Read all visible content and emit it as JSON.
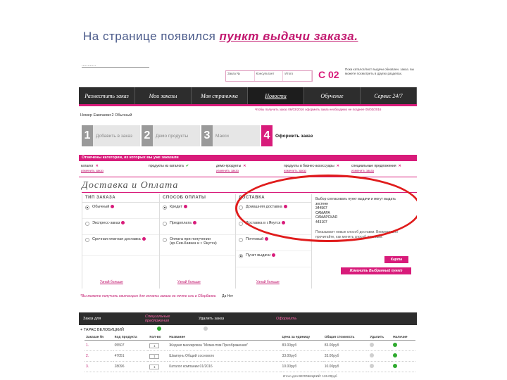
{
  "slide": {
    "title_prefix": "На странице появился",
    "title_highlight": "пункт выдачи заказа."
  },
  "header": {
    "logo_scrap": "............",
    "mini_table": [
      "Заказ №",
      "Консультант",
      "Итого"
    ],
    "cart_code": "С 02",
    "cart_note": "Пока каталог/лист выдачи обновлен. заказ. вы можете посмотреть в других разделах."
  },
  "nav": {
    "items": [
      "Разместить заказ",
      "Мои заказы",
      "Моя страничка",
      "Новости",
      "Обучение",
      "Сервис 24/7"
    ],
    "active_index": 3
  },
  "deadline_text": "Чтобы получить заказ 06/03/2016 оформить заказ необходимо не позднее 05/03/2016",
  "user_line": "Номер Еамгаеви:2  Обычный",
  "steps": [
    {
      "num": "1",
      "label": "Добавить в заказ"
    },
    {
      "num": "2",
      "label": "Демо продукты"
    },
    {
      "num": "3",
      "label": "Макси"
    },
    {
      "num": "4",
      "label": "Оформить заказ"
    }
  ],
  "active_step": 3,
  "categories_title": "Отмечены категории, из которых вы уже заказали",
  "categories": [
    {
      "name": "каталог",
      "mark": "x",
      "link": "изменить заказ"
    },
    {
      "name": "продукты из каталога",
      "mark": "ok",
      "link": ""
    },
    {
      "name": "демо-продукты",
      "mark": "x",
      "link": "изменить заказ"
    },
    {
      "name": "продукты в бизнес-аксессуары",
      "mark": "x",
      "link": "изменить заказ"
    },
    {
      "name": "специальные предложения",
      "mark": "x",
      "link": "изменить заказ"
    }
  ],
  "section_title": "Доставка и Оплата",
  "order_type": {
    "header": "ТИП ЗАКАЗА",
    "options": [
      "Обычный",
      "Экспресс-заказ",
      "Срочная платная доставка"
    ],
    "selected": 0,
    "more": "Узнай больше"
  },
  "payment": {
    "header": "СПОСОБ ОПЛАТЫ",
    "options": [
      "Кредит",
      "Предоплата",
      "Оплата при получении (кр.Сев.Кавказ и г. Якутск)"
    ],
    "selected": 0,
    "more": "Узнай больше"
  },
  "delivery": {
    "header": "ДОСТАВКА",
    "options": [
      "Домашняя доставка",
      "Доставка в г.Якутск",
      "Почтовый",
      "Пункт выдачи"
    ],
    "selected": 3,
    "more": "Узнай больше"
  },
  "pickup": {
    "intro": "Выбор согласовать пункт выдачи и могут выдать",
    "lines": [
      "зостенн",
      "344567",
      "САМАРА",
      "САМАРСКАЯ",
      "443107"
    ],
    "note": "Показывает новые способ доставки. Внимательно прочитайте, как менять способ доставки.",
    "map_button": "Карта",
    "change_button": "Изменить Выбранный пункт"
  },
  "pay_note": "*Вы можете получить квитанцию для оплаты заказа на почте или в Сбербанке.",
  "pay_note_radios": "Да     Нет",
  "order_header": {
    "col1": "Заказ для",
    "col2": "Специальные предложения",
    "col3": "Удалить заказ",
    "col4": "Оформить"
  },
  "owner": "+ ТАРАС ВЕЛОБИЦКИЙ",
  "table": {
    "headers": [
      "Заказан №",
      "Код продукта",
      "Кол-во",
      "Название",
      "Цена за единицу",
      "Общая стоимость",
      "Удалить",
      "Наличие"
    ],
    "rows": [
      [
        "1.",
        "05507",
        "1",
        "Жидкая маскировка \"Моментом Преображения\"",
        "83.00руб",
        "83.00руб"
      ],
      [
        "2.",
        "47051",
        "1",
        "Шампунь Общий соснового",
        "33.00руб",
        "33.00руб"
      ],
      [
        "3.",
        "28096",
        "1",
        "Каталог компании 01/2016",
        "10.00руб",
        "10.00руб"
      ]
    ]
  },
  "total": "Итого для ВЕЛОБИЦКИЙ: 126.00руб"
}
